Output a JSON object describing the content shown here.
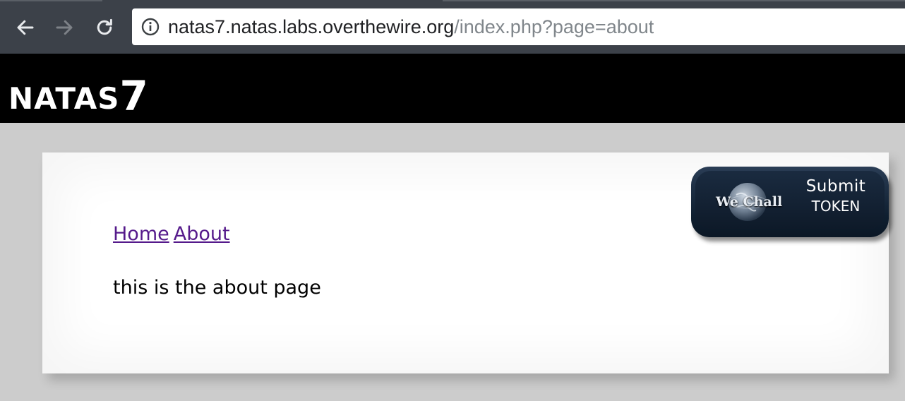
{
  "browser": {
    "url_host": "natas7.natas.labs.overthewire.org",
    "url_path": "/index.php?page=about",
    "back_icon": "arrow-left-icon",
    "forward_icon": "arrow-right-icon",
    "reload_icon": "reload-icon",
    "info_icon": "info-icon"
  },
  "header": {
    "title": "NATAS",
    "title_number": "7"
  },
  "nav": {
    "home_label": "Home",
    "about_label": "About"
  },
  "main": {
    "text": "this is the about page"
  },
  "wechall": {
    "brand": "We Chall",
    "submit_line1": "Submit",
    "submit_line2": "TOKEN",
    "globe_icon": "globe-icon"
  },
  "colors": {
    "chrome_bg": "#3c4149",
    "header_bg": "#000000",
    "page_bg": "#cccccc",
    "link_visited": "#551a8b",
    "badge_bg": "#0f1f30"
  }
}
